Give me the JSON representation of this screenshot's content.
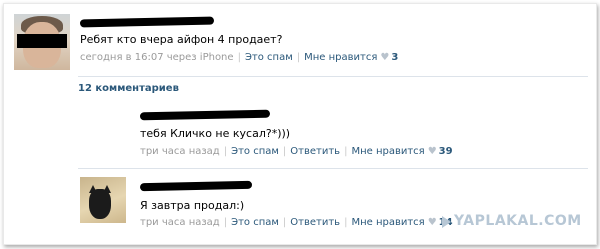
{
  "post": {
    "text": "Ребят кто вчера айфон 4 продает?",
    "timestamp": "сегодня в 16:07 через iPhone",
    "spam_link": "Это спам",
    "like_link": "Мне нравится",
    "like_count": "3"
  },
  "comments_count": "12 комментариев",
  "comments": [
    {
      "text": "тебя Кличко не кусал?*)))",
      "time": "три часа назад",
      "spam_link": "Это спам",
      "reply_link": "Ответить",
      "like_link": "Мне нравится",
      "like_count": "39"
    },
    {
      "text": "Я завтра продал:)",
      "time": "три часа назад",
      "spam_link": "Это спам",
      "reply_link": "Ответить",
      "like_link": "Мне нравится",
      "like_count": "14"
    }
  ],
  "watermark": "YAPLAKAL.COM",
  "icons": {
    "like": "heart-icon",
    "watermark": "yaplakal-logo-icon"
  },
  "colors": {
    "link": "#2b587a",
    "meta": "#9a9a9a",
    "heart": "#b9c3cd",
    "watermark": "#b7c7d5"
  }
}
